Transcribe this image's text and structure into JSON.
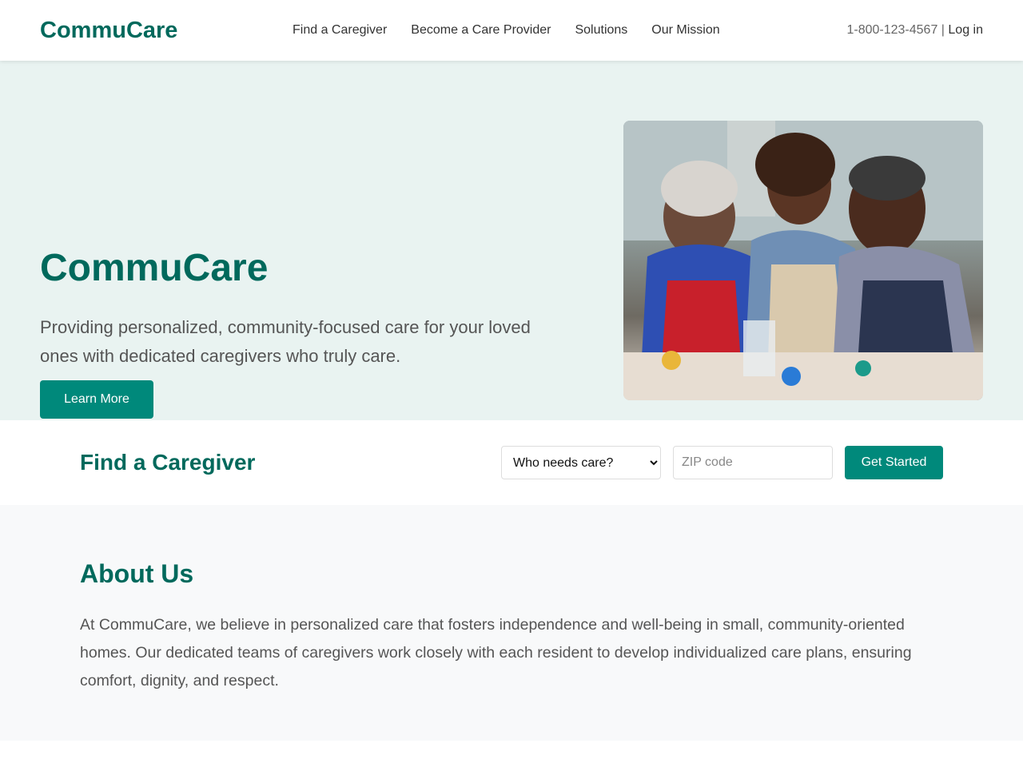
{
  "header": {
    "logo": "CommuCare",
    "nav": [
      "Find a Caregiver",
      "Become a Care Provider",
      "Solutions",
      "Our Mission"
    ],
    "phone": "1-800-123-4567",
    "separator": " | ",
    "login": "Log in"
  },
  "hero": {
    "title": "CommuCare",
    "subtitle": "Providing personalized, community-focused care for your loved ones with dedicated caregivers who truly care.",
    "cta": "Learn More",
    "image_alt": "Seniors and caregiver painting together"
  },
  "find": {
    "title": "Find a Caregiver",
    "select_value": "Who needs care?",
    "zip_placeholder": "ZIP code",
    "submit": "Get Started"
  },
  "about": {
    "title": "About Us",
    "body": "At CommuCare, we believe in personalized care that fosters independence and well-being in small, community-oriented homes. Our dedicated teams of caregivers work closely with each resident to develop individualized care plans, ensuring comfort, dignity, and respect."
  },
  "colors": {
    "brand": "#00695c",
    "button": "#00897b",
    "hero_bg": "#e9f3f1"
  }
}
